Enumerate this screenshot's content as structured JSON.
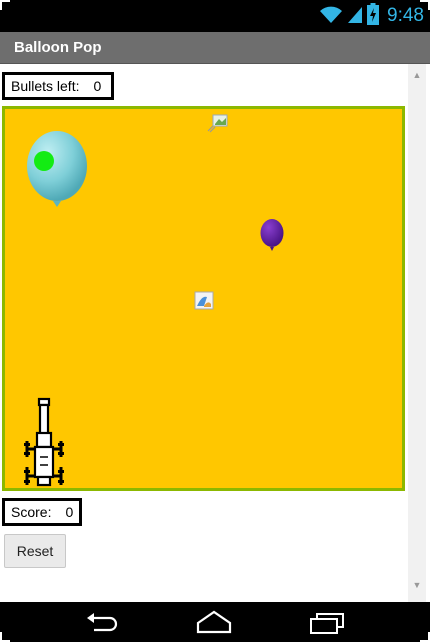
{
  "status_bar": {
    "time": "9:48",
    "icons": [
      "wifi-icon",
      "signal-icon",
      "battery-icon"
    ],
    "accent": "#33b5e5"
  },
  "app": {
    "title": "Balloon Pop"
  },
  "bullets": {
    "label": "Bullets left:",
    "value": "0"
  },
  "score": {
    "label": "Score:",
    "value": "0"
  },
  "reset_button": {
    "label": "Reset"
  },
  "canvas": {
    "background": "#ffc700",
    "border": "#8cb800",
    "sprites": [
      "light-blue-balloon",
      "purple-balloon",
      "green-target-dot",
      "cannon",
      "broken-image-icon",
      "broken-image-icon"
    ]
  },
  "nav_bar": {
    "buttons": [
      "back-icon",
      "home-icon",
      "recent-apps-icon"
    ]
  }
}
